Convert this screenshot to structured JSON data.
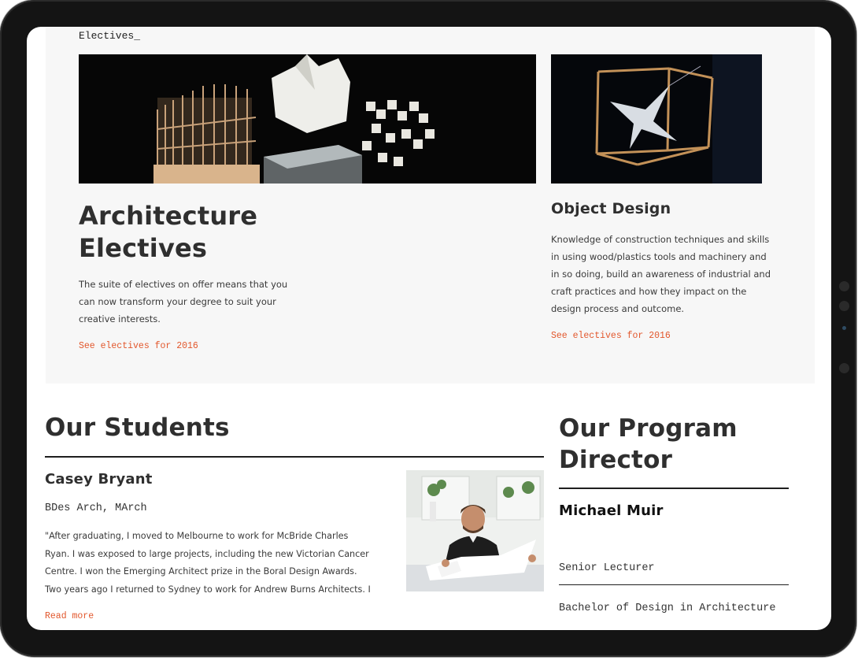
{
  "electives": {
    "section_label": "Electives_",
    "architecture": {
      "title_line1": "Architecture",
      "title_line2": "Electives",
      "description_lines": [
        "The suite of electives on offer means that you",
        "can now transform your degree to suit your",
        "creative interests."
      ],
      "link": "See electives for 2016"
    },
    "object_design": {
      "title": "Object Design",
      "description_lines": [
        "Knowledge of construction techniques and skills",
        "in using wood/plastics tools and machinery and",
        "in so doing, build an awareness of industrial and",
        "craft practices and how they impact on the",
        "design process and outcome."
      ],
      "link": "See electives for 2016"
    }
  },
  "students": {
    "heading": "Our Students",
    "name": "Casey Bryant",
    "degree": "BDes Arch, MArch",
    "quote_lines": [
      "\"After graduating, I moved to Melbourne to work for McBride Charles",
      "Ryan. I was exposed to large projects, including the new Victorian Cancer",
      "Centre. I won the Emerging Architect prize in the Boral Design Awards.",
      "Two years ago I returned to Sydney to work for Andrew Burns Architects. I"
    ],
    "read_more": "Read more"
  },
  "director": {
    "heading_line1": "Our Program",
    "heading_line2": "Director",
    "name": "Michael Muir",
    "role_line1": "Senior Lecturer",
    "role_line2": "Bachelor of Design in Architecture"
  },
  "colors": {
    "accent": "#e2572c",
    "text": "#2f2f2f",
    "panel": "#f7f7f7",
    "frame": "#141414"
  }
}
